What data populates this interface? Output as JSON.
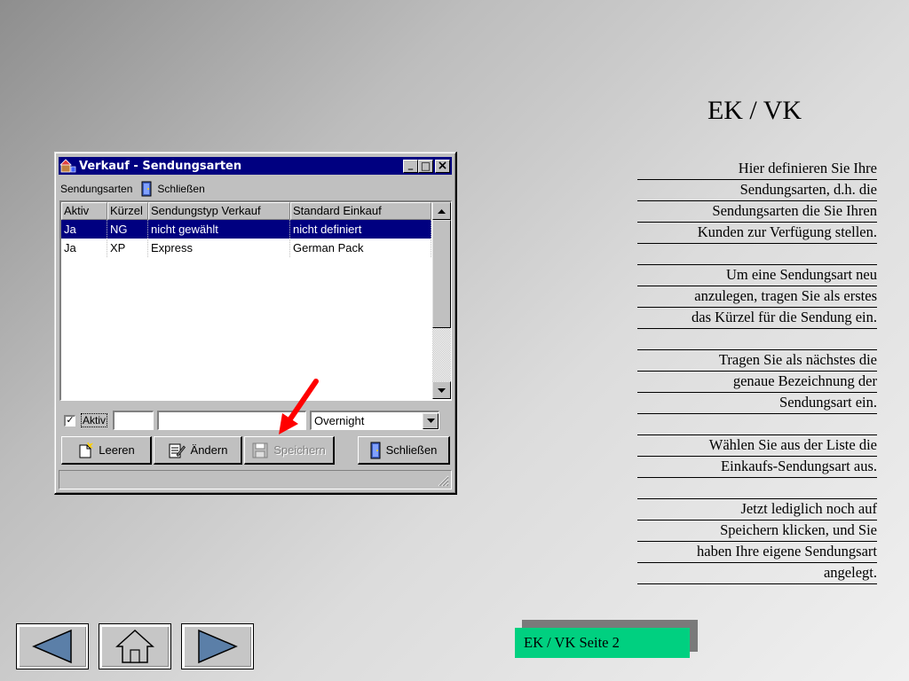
{
  "window": {
    "title": "Verkauf - Sendungsarten",
    "minimize": "_",
    "maximize": "□",
    "close": "×"
  },
  "menu": {
    "sendungsarten": "Sendungsarten",
    "schliessen": "Schließen"
  },
  "list": {
    "columns": [
      "Aktiv",
      "Kürzel",
      "Sendungstyp Verkauf",
      "Standard Einkauf"
    ],
    "rows": [
      {
        "aktiv": "Ja",
        "kuerzel": "NG",
        "verkauf": "nicht gewählt",
        "einkauf": "nicht definiert",
        "selected": true
      },
      {
        "aktiv": "Ja",
        "kuerzel": "XP",
        "verkauf": "Express",
        "einkauf": "German Pack",
        "selected": false
      }
    ]
  },
  "editor": {
    "aktiv_checked": "✓",
    "aktiv_label": "Aktiv",
    "kuerzel_value": "",
    "name_value": "",
    "einkauf_selected": "Overnight"
  },
  "buttons": {
    "leeren": "Leeren",
    "aendern": "Ändern",
    "speichern": "Speichern",
    "schliessen": "Schließen"
  },
  "slide": {
    "heading": "EK / VK",
    "instructions": [
      "Hier definieren Sie Ihre",
      "Sendungsarten, d.h. die",
      "Sendungsarten die Sie Ihren",
      "Kunden zur Verfügung stellen.",
      "",
      "Um eine Sendungsart neu",
      "anzulegen, tragen Sie als erstes",
      "das Kürzel für die Sendung ein.",
      "",
      "Tragen Sie als nächstes die",
      "genaue Bezeichnung der",
      "Sendungsart ein.",
      "",
      "Wählen Sie aus der Liste die",
      "Einkaufs-Sendungsart aus.",
      "",
      "Jetzt lediglich noch auf",
      "Speichern klicken, und Sie",
      "haben Ihre eigene Sendungsart",
      "angelegt."
    ],
    "page_label": "EK / VK Seite 2",
    "accent_color": "#00d080",
    "arrow_color": "#ff0000"
  },
  "nav": {
    "back_icon": "left-triangle",
    "home_icon": "house",
    "forward_icon": "right-triangle"
  }
}
